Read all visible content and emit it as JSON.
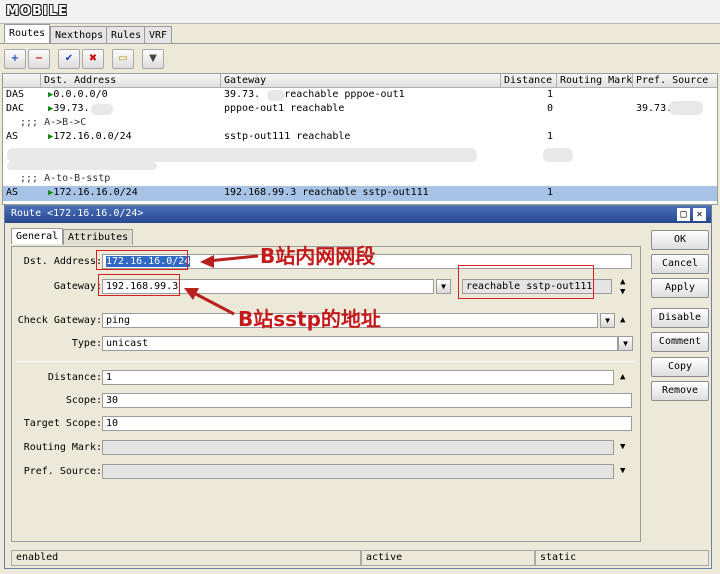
{
  "logo": "MOBILE",
  "tabs": [
    "Routes",
    "Nexthops",
    "Rules",
    "VRF"
  ],
  "toolbar": {
    "add": "+",
    "remove": "−",
    "enable": "✔",
    "disable": "✖",
    "comment": "▭",
    "filter": "▼"
  },
  "table": {
    "columns": [
      "Dst. Address",
      "Gateway",
      "Distance",
      "Routing Mark",
      "Pref. Source"
    ],
    "rows": [
      {
        "flags": "DAS",
        "dst": "0.0.0.0/0",
        "gateway": "39.73.   .1 reachable pppoe-out1",
        "distance": "1",
        "pref": ""
      },
      {
        "flags": "DAC",
        "dst": "39.73.   .1",
        "gateway": "pppoe-out1 reachable",
        "distance": "0",
        "pref": "39.73."
      },
      {
        "comment": ";;; A->B->C"
      },
      {
        "flags": "AS",
        "dst": "172.16.0.0/24",
        "gateway": "sstp-out111 reachable",
        "distance": "1",
        "pref": ""
      },
      {
        "comment": ";;; A-to-B-sstp"
      },
      {
        "flags": "AS",
        "dst": "172.16.16.0/24",
        "gateway": "192.168.99.3 reachable sstp-out111",
        "distance": "1",
        "pref": ""
      }
    ]
  },
  "dialog": {
    "title": "Route <172.16.16.0/24>",
    "tabs": [
      "General",
      "Attributes"
    ],
    "fields": {
      "dst_label": "Dst. Address:",
      "dst_value": "172.16.16.0/24",
      "gateway_label": "Gateway:",
      "gateway_value": "192.168.99.3",
      "gateway_status": "reachable sstp-out111",
      "check_gateway_label": "Check Gateway:",
      "check_gateway_value": "ping",
      "type_label": "Type:",
      "type_value": "unicast",
      "distance_label": "Distance:",
      "distance_value": "1",
      "scope_label": "Scope:",
      "scope_value": "30",
      "target_scope_label": "Target Scope:",
      "target_scope_value": "10",
      "routing_mark_label": "Routing Mark:",
      "routing_mark_value": "",
      "pref_source_label": "Pref. Source:",
      "pref_source_value": ""
    },
    "buttons": [
      "OK",
      "Cancel",
      "Apply",
      "Disable",
      "Comment",
      "Copy",
      "Remove"
    ],
    "status": [
      "enabled",
      "active",
      "static"
    ]
  },
  "annotations": {
    "dst": "B站内网网段",
    "gateway": "B站sstp的地址"
  },
  "colors": {
    "annotation_red": "#d61f1f",
    "selected_row": "#a7c3e6",
    "title_bar": "#27488f"
  }
}
